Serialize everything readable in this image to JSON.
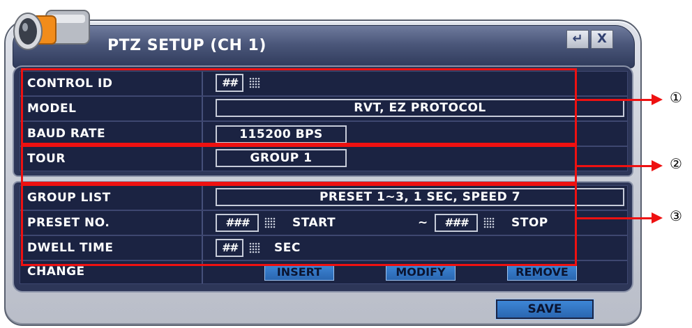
{
  "dialog": {
    "title": "PTZ SETUP (CH 1)",
    "enter_symbol": "↵",
    "close_symbol": "X"
  },
  "rows": {
    "control_id": {
      "label": "CONTROL ID",
      "value": "##"
    },
    "model": {
      "label": "MODEL",
      "value": "RVT, EZ PROTOCOL"
    },
    "baud_rate": {
      "label": "BAUD RATE",
      "value": "115200 BPS"
    },
    "tour": {
      "label": "TOUR",
      "value": "GROUP 1"
    },
    "group_list": {
      "label": "GROUP LIST",
      "value": "PRESET 1~3, 1 SEC, SPEED 7"
    },
    "preset_no": {
      "label": "PRESET NO.",
      "start_value": "###",
      "start_text": "START",
      "separator": "~",
      "stop_value": "###",
      "stop_text": "STOP"
    },
    "dwell_time": {
      "label": "DWELL TIME",
      "value": "##",
      "unit": "SEC"
    },
    "change": {
      "label": "CHANGE",
      "insert_label": "INSERT",
      "modify_label": "MODIFY",
      "remove_label": "REMOVE"
    }
  },
  "save_label": "SAVE",
  "callouts": [
    "①",
    "②",
    "③"
  ],
  "colors": {
    "annotation": "#ee1111",
    "panel": "#2d3658",
    "button": "#2f73c2"
  },
  "icons": [
    "camera-icon",
    "enter-icon",
    "close-icon",
    "keypad-icon",
    "arrow-icon"
  ]
}
